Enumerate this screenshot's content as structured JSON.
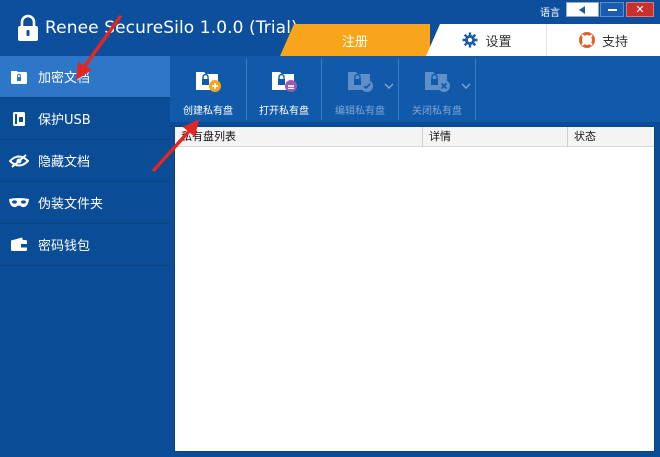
{
  "app": {
    "title": "Renee SecureSilo 1.0.0 (Trial)",
    "language_label": "语言"
  },
  "tabs": [
    {
      "label": "注册",
      "icon": "none"
    },
    {
      "label": "设置",
      "icon": "gear-icon"
    },
    {
      "label": "支持",
      "icon": "lifebuoy-icon"
    }
  ],
  "sidebar": {
    "items": [
      {
        "label": "加密文档",
        "icon": "lock-folder-icon",
        "active": true
      },
      {
        "label": "保护USB",
        "icon": "usb-icon",
        "active": false
      },
      {
        "label": "隐藏文档",
        "icon": "eye-slash-icon",
        "active": false
      },
      {
        "label": "伪装文件夹",
        "icon": "mask-icon",
        "active": false
      },
      {
        "label": "密码钱包",
        "icon": "wallet-icon",
        "active": false
      }
    ]
  },
  "toolbar": {
    "items": [
      {
        "label": "创建私有盘",
        "icon": "folder-lock-add-icon",
        "enabled": true
      },
      {
        "label": "打开私有盘",
        "icon": "folder-lock-open-icon",
        "enabled": true
      },
      {
        "label": "编辑私有盘",
        "icon": "folder-lock-edit-icon",
        "enabled": false
      },
      {
        "label": "关闭私有盘",
        "icon": "folder-lock-close-icon",
        "enabled": false
      }
    ]
  },
  "table": {
    "columns": [
      "私有盘列表",
      "详情",
      "状态"
    ]
  },
  "colors": {
    "accent_orange": "#f7a51a",
    "primary_blue": "#0b4c97",
    "active_item": "#2d76c8",
    "toolbar_blue": "#115aaa",
    "annotation_red": "#e3261f"
  }
}
